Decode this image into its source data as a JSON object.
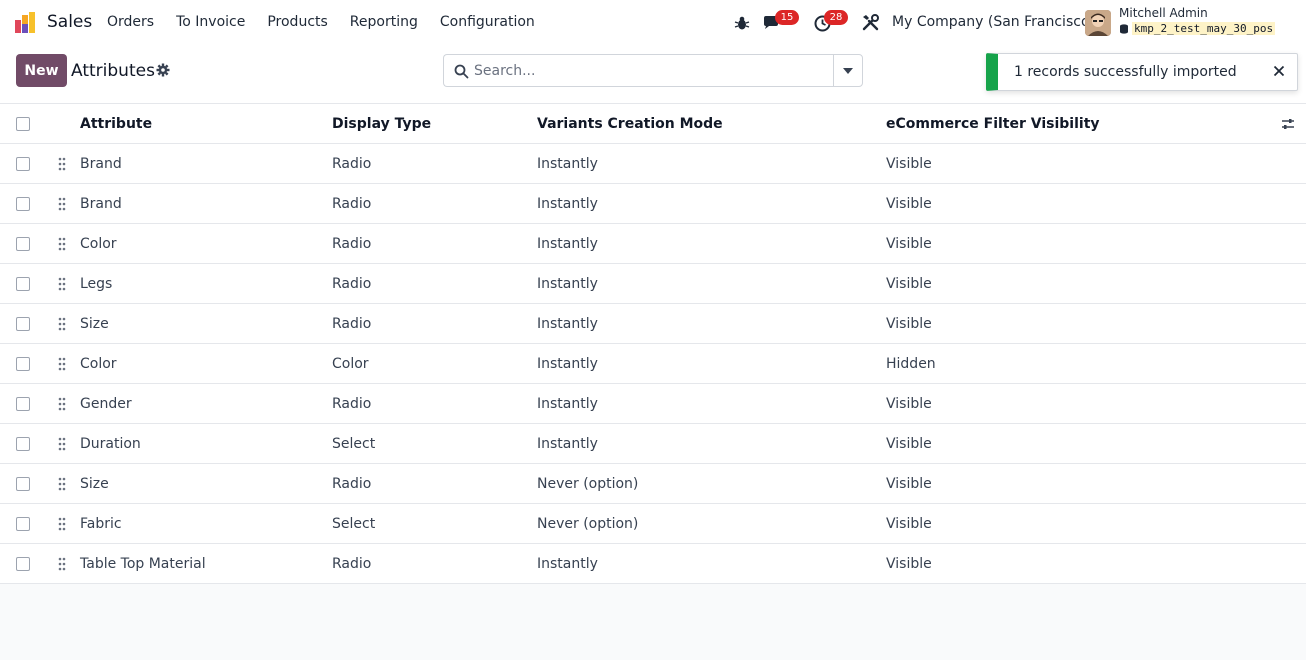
{
  "navbar": {
    "app_name": "Sales",
    "menu": [
      "Orders",
      "To Invoice",
      "Products",
      "Reporting",
      "Configuration"
    ],
    "messages_count": "15",
    "activities_count": "28",
    "company": "My Company (San Francisco)",
    "user_name": "Mitchell Admin",
    "database": "kmp_2_test_may_30_pos"
  },
  "control_panel": {
    "new_label": "New",
    "title": "Attributes",
    "search_placeholder": "Search..."
  },
  "toast": {
    "message": "1 records successfully imported"
  },
  "table": {
    "columns": [
      "Attribute",
      "Display Type",
      "Variants Creation Mode",
      "eCommerce Filter Visibility"
    ],
    "rows": [
      [
        "Brand",
        "Radio",
        "Instantly",
        "Visible"
      ],
      [
        "Brand",
        "Radio",
        "Instantly",
        "Visible"
      ],
      [
        "Color",
        "Radio",
        "Instantly",
        "Visible"
      ],
      [
        "Legs",
        "Radio",
        "Instantly",
        "Visible"
      ],
      [
        "Size",
        "Radio",
        "Instantly",
        "Visible"
      ],
      [
        "Color",
        "Color",
        "Instantly",
        "Hidden"
      ],
      [
        "Gender",
        "Radio",
        "Instantly",
        "Visible"
      ],
      [
        "Duration",
        "Select",
        "Instantly",
        "Visible"
      ],
      [
        "Size",
        "Radio",
        "Never (option)",
        "Visible"
      ],
      [
        "Fabric",
        "Select",
        "Never (option)",
        "Visible"
      ],
      [
        "Table Top Material",
        "Radio",
        "Instantly",
        "Visible"
      ]
    ]
  },
  "colors": {
    "brand": "#714b67",
    "badge": "#dc2626",
    "success": "#16a34a"
  },
  "icons": {
    "app_logo": "sales-logo-icon",
    "bug": "bug-icon",
    "chat": "chat-icon",
    "activity": "clock-icon",
    "settings": "tools-icon",
    "gear": "gear-icon",
    "search": "search-icon",
    "close": "close-icon",
    "drag": "drag-handle-icon",
    "optional_columns": "sliders-icon"
  }
}
